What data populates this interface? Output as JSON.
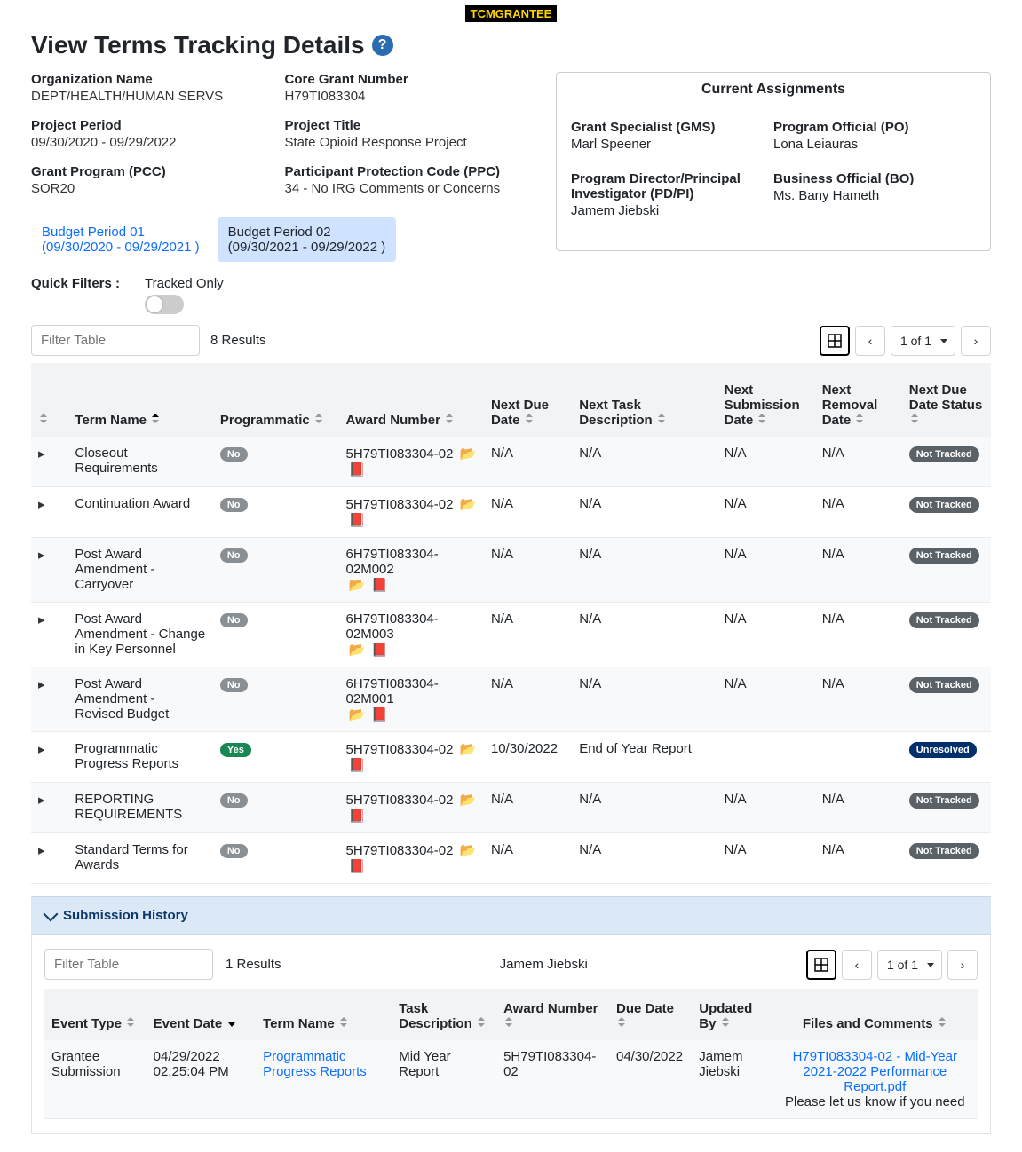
{
  "tag": "TCMGRANTEE",
  "title": "View Terms Tracking Details",
  "info": {
    "org_lbl": "Organization Name",
    "org_val": "DEPT/HEALTH/HUMAN SERVS",
    "core_lbl": "Core Grant Number",
    "core_val": "H79TI083304",
    "period_lbl": "Project Period",
    "period_val": "09/30/2020 - 09/29/2022",
    "ptitle_lbl": "Project Title",
    "ptitle_val": "State Opioid Response Project",
    "pcc_lbl": "Grant Program (PCC)",
    "pcc_val": "SOR20",
    "ppc_lbl": "Participant Protection Code (PPC)",
    "ppc_val": "34 - No IRG Comments or Concerns"
  },
  "assign": {
    "heading": "Current Assignments",
    "gms_lbl": "Grant Specialist (GMS)",
    "gms_val": "Marl  Speener",
    "po_lbl": "Program Official (PO)",
    "po_val": "Lona Leiauras",
    "pdpi_lbl": "Program Director/Principal Investigator (PD/PI)",
    "pdpi_val": "Jamem   Jiebski",
    "bo_lbl": "Business Official (BO)",
    "bo_val": "Ms. Bany Hameth"
  },
  "tabs": {
    "bp1_lbl": "Budget Period 01",
    "bp1_dates": "(09/30/2020 - 09/29/2021 )",
    "bp2_lbl": "Budget Period 02",
    "bp2_dates": "(09/30/2021 - 09/29/2022 )"
  },
  "qf_lbl": "Quick Filters :",
  "tracked_lbl": "Tracked Only",
  "filter_ph": "Filter Table",
  "results": "8 Results",
  "pager": "1 of 1",
  "cols": {
    "c1": "Term Name",
    "c2": "Programmatic",
    "c3": "Award Number",
    "c4": "Next Due Date",
    "c5": "Next Task Description",
    "c6": "Next Submission Date",
    "c7": "Next Removal Date",
    "c8": "Next Due Date Status"
  },
  "rows": [
    {
      "name": "Closeout Requirements",
      "prog": "No",
      "award": "5H79TI083304-02",
      "due": "N/A",
      "task": "N/A",
      "sub": "N/A",
      "rem": "N/A",
      "status": "Not Tracked"
    },
    {
      "name": "Continuation Award",
      "prog": "No",
      "award": "5H79TI083304-02",
      "due": "N/A",
      "task": "N/A",
      "sub": "N/A",
      "rem": "N/A",
      "status": "Not Tracked"
    },
    {
      "name": "Post Award Amendment - Carryover",
      "prog": "No",
      "award": "6H79TI083304-02M002",
      "due": "N/A",
      "task": "N/A",
      "sub": "N/A",
      "rem": "N/A",
      "status": "Not Tracked"
    },
    {
      "name": "Post Award Amendment - Change in Key Personnel",
      "prog": "No",
      "award": "6H79TI083304-02M003",
      "due": "N/A",
      "task": "N/A",
      "sub": "N/A",
      "rem": "N/A",
      "status": "Not Tracked"
    },
    {
      "name": "Post Award Amendment - Revised Budget",
      "prog": "No",
      "award": "6H79TI083304-02M001",
      "due": "N/A",
      "task": "N/A",
      "sub": "N/A",
      "rem": "N/A",
      "status": "Not Tracked"
    },
    {
      "name": "Programmatic Progress Reports",
      "prog": "Yes",
      "award": "5H79TI083304-02",
      "due": "10/30/2022",
      "task": "End of Year Report",
      "sub": "",
      "rem": "",
      "status": "Unresolved"
    },
    {
      "name": "REPORTING REQUIREMENTS",
      "prog": "No",
      "award": "5H79TI083304-02",
      "due": "N/A",
      "task": "N/A",
      "sub": "N/A",
      "rem": "N/A",
      "status": "Not Tracked"
    },
    {
      "name": "Standard Terms for Awards",
      "prog": "No",
      "award": "5H79TI083304-02",
      "due": "N/A",
      "task": "N/A",
      "sub": "N/A",
      "rem": "N/A",
      "status": "Not Tracked"
    }
  ],
  "sh": {
    "heading": "Submission History",
    "filter_ph": "Filter Table",
    "results": "1 Results",
    "name": "Jamem   Jiebski",
    "pager": "1 of 1",
    "cols": {
      "c1": "Event Type",
      "c2": "Event Date",
      "c3": "Term Name",
      "c4": "Task Description",
      "c5": "Award Number",
      "c6": "Due Date",
      "c7": "Updated By",
      "c8": "Files and Comments"
    },
    "row": {
      "etype": "Grantee Submission",
      "edate": "04/29/2022 02:25:04 PM",
      "tname": "Programmatic Progress Reports",
      "task": "Mid Year Report",
      "award": "5H79TI083304-02",
      "due": "04/30/2022",
      "upd": "Jamem Jiebski",
      "file": "H79TI083304-02 - Mid-Year 2021-2022 Performance Report.pdf",
      "comment": "Please let us know if you need"
    }
  }
}
